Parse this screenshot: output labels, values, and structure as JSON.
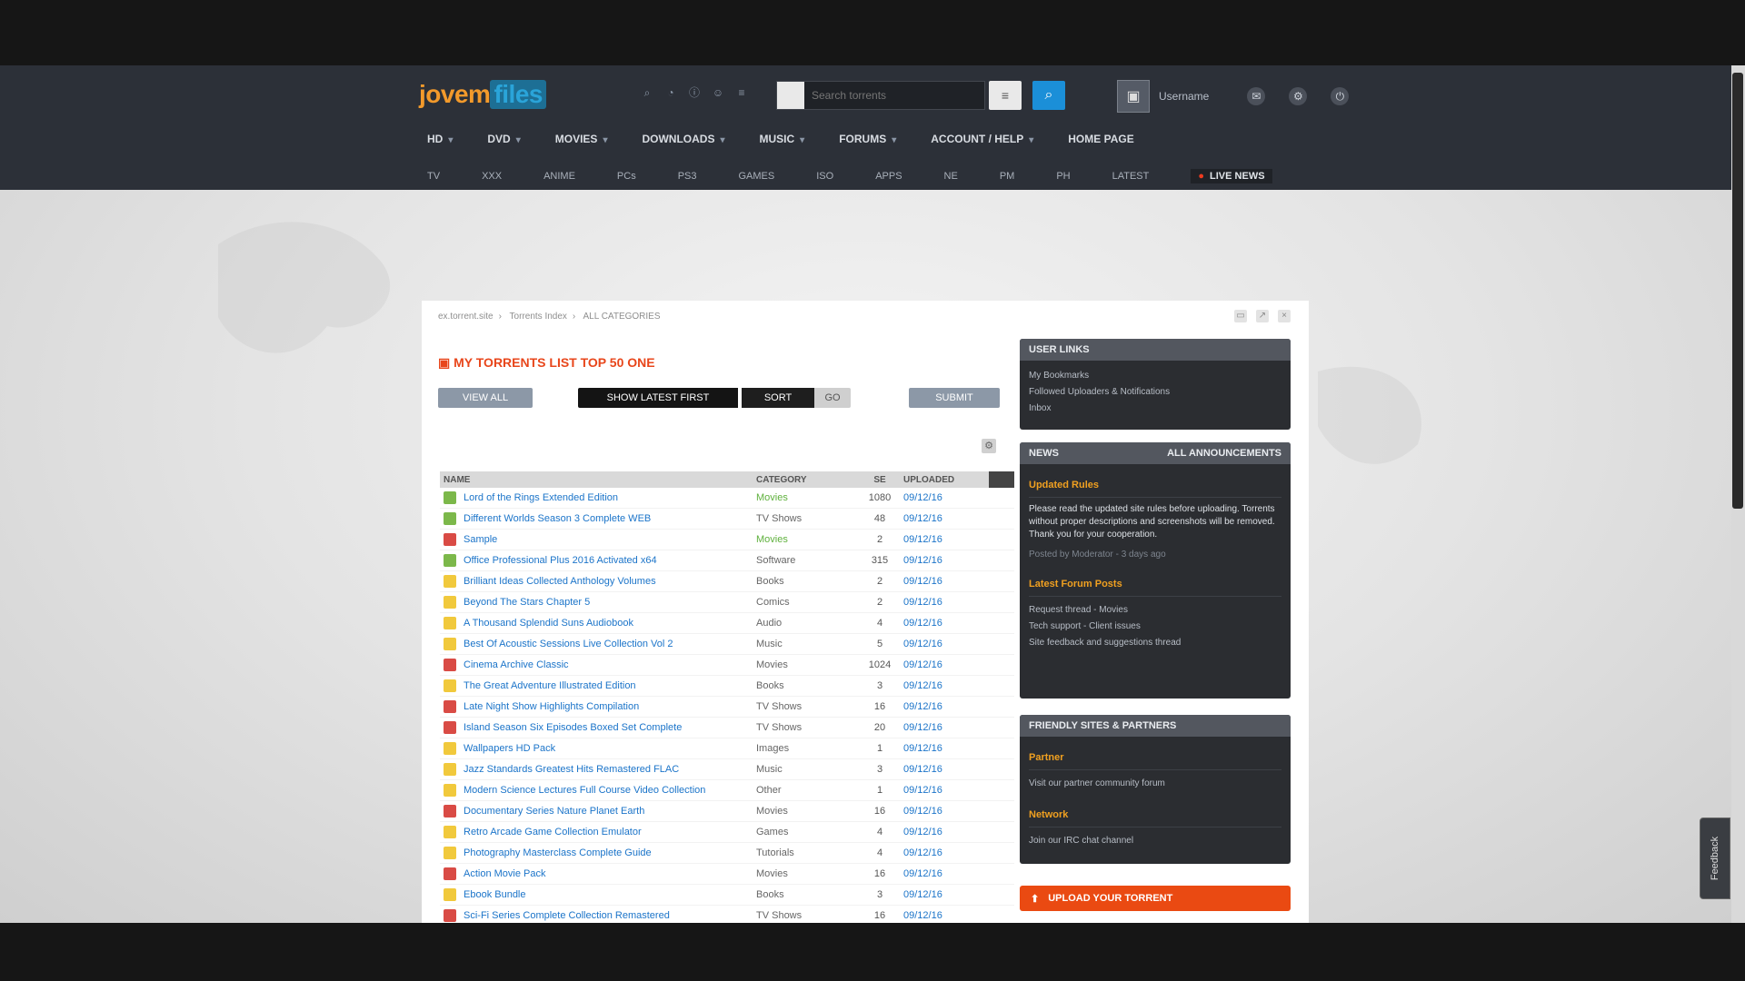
{
  "header": {
    "logo_part1": "jovem",
    "logo_part2": "files",
    "search_placeholder": "Search torrents",
    "search_checkbox": "",
    "adv_button": "≡",
    "search_button": "⌕",
    "username": "Username",
    "toolbar_icons": [
      "search-icon",
      "rss-icon",
      "info-icon",
      "user-icon",
      "list-icon"
    ]
  },
  "mainnav": [
    {
      "label": "HD",
      "has_caret": true
    },
    {
      "label": "DVD",
      "has_caret": true
    },
    {
      "label": "MOVIES",
      "has_caret": true
    },
    {
      "label": "DOWNLOADS",
      "has_caret": true
    },
    {
      "label": "MUSIC",
      "has_caret": true
    },
    {
      "label": "FORUMS",
      "has_caret": true
    },
    {
      "label": "ACCOUNT / HELP",
      "has_caret": true
    },
    {
      "label": "HOME PAGE",
      "has_caret": false
    }
  ],
  "subnav": {
    "items": [
      "TV",
      "XXX",
      "ANIME",
      "PCs",
      "PS3",
      "GAMES",
      "ISO",
      "APPS",
      "NE",
      "PM",
      "PH",
      "LATEST"
    ],
    "live_label": "LIVE NEWS"
  },
  "card": {
    "breadcrumb": [
      "ex.torrent.site",
      "Torrents Index",
      "ALL CATEGORIES"
    ],
    "title": "MY TORRENTS LIST TOP 50 ONE",
    "btn_left": "VIEW ALL",
    "seg_a": "SHOW LATEST FIRST",
    "seg_b": "SORT",
    "seg_c": "GO",
    "btn_right": "SUBMIT",
    "gear": "⚙",
    "columns": [
      "NAME",
      "CATEGORY",
      "SE",
      "UPLOADED",
      ""
    ]
  },
  "torrents": [
    {
      "status": "g",
      "name": "Lord of the Rings Extended Edition",
      "category": "Movies",
      "cat_green": true,
      "files": "1080",
      "date": "09/12/16"
    },
    {
      "status": "g",
      "name": "Different Worlds Season 3 Complete WEB",
      "category": "TV Shows",
      "cat_green": false,
      "files": "48",
      "date": "09/12/16"
    },
    {
      "status": "r",
      "name": "Sample",
      "category": "Movies",
      "cat_green": true,
      "files": "2",
      "date": "09/12/16"
    },
    {
      "status": "g",
      "name": "Office Professional Plus 2016 Activated x64",
      "category": "Software",
      "cat_green": false,
      "files": "315",
      "date": "09/12/16"
    },
    {
      "status": "y",
      "name": "Brilliant Ideas Collected Anthology Volumes",
      "category": "Books",
      "cat_green": false,
      "files": "2",
      "date": "09/12/16"
    },
    {
      "status": "y",
      "name": "Beyond The Stars Chapter 5",
      "category": "Comics",
      "cat_green": false,
      "files": "2",
      "date": "09/12/16"
    },
    {
      "status": "y",
      "name": "A Thousand Splendid Suns Audiobook",
      "category": "Audio",
      "cat_green": false,
      "files": "4",
      "date": "09/12/16"
    },
    {
      "status": "y",
      "name": "Best Of Acoustic Sessions Live Collection Vol 2",
      "category": "Music",
      "cat_green": false,
      "files": "5",
      "date": "09/12/16"
    },
    {
      "status": "r",
      "name": "Cinema Archive Classic",
      "category": "Movies",
      "cat_green": false,
      "files": "1024",
      "date": "09/12/16"
    },
    {
      "status": "y",
      "name": "The Great Adventure Illustrated Edition",
      "category": "Books",
      "cat_green": false,
      "files": "3",
      "date": "09/12/16"
    },
    {
      "status": "r",
      "name": "Late Night Show Highlights Compilation",
      "category": "TV Shows",
      "cat_green": false,
      "files": "16",
      "date": "09/12/16"
    },
    {
      "status": "r",
      "name": "Island Season Six Episodes Boxed Set Complete",
      "category": "TV Shows",
      "cat_green": false,
      "files": "20",
      "date": "09/12/16"
    },
    {
      "status": "y",
      "name": "Wallpapers HD Pack",
      "category": "Images",
      "cat_green": false,
      "files": "1",
      "date": "09/12/16"
    },
    {
      "status": "y",
      "name": "Jazz Standards Greatest Hits Remastered FLAC",
      "category": "Music",
      "cat_green": false,
      "files": "3",
      "date": "09/12/16"
    },
    {
      "status": "y",
      "name": "Modern Science Lectures Full Course Video Collection",
      "category": "Other",
      "cat_green": false,
      "files": "1",
      "date": "09/12/16"
    },
    {
      "status": "r",
      "name": "Documentary Series Nature Planet Earth",
      "category": "Movies",
      "cat_green": false,
      "files": "16",
      "date": "09/12/16"
    },
    {
      "status": "y",
      "name": "Retro Arcade Game Collection Emulator",
      "category": "Games",
      "cat_green": false,
      "files": "4",
      "date": "09/12/16"
    },
    {
      "status": "y",
      "name": "Photography Masterclass Complete Guide",
      "category": "Tutorials",
      "cat_green": false,
      "files": "4",
      "date": "09/12/16"
    },
    {
      "status": "r",
      "name": "Action Movie Pack",
      "category": "Movies",
      "cat_green": false,
      "files": "16",
      "date": "09/12/16"
    },
    {
      "status": "y",
      "name": "Ebook Bundle",
      "category": "Books",
      "cat_green": false,
      "files": "3",
      "date": "09/12/16"
    },
    {
      "status": "r",
      "name": "Sci-Fi Series Complete Collection Remastered",
      "category": "TV Shows",
      "cat_green": false,
      "files": "16",
      "date": "09/12/16"
    }
  ],
  "sidebar": {
    "panel1": {
      "title": "USER LINKS",
      "lines": [
        "My Bookmarks",
        "Followed Uploaders & Notifications",
        "Inbox"
      ]
    },
    "panel2": {
      "title": "NEWS",
      "right": "ALL ANNOUNCEMENTS",
      "sub1": "Updated Rules",
      "news": "Please read the updated site rules before uploading. Torrents without proper descriptions and screenshots will be removed. Thank you for your cooperation.",
      "meta": "Posted by Moderator - 3 days ago",
      "sub2": "Latest Forum Posts",
      "posts": [
        "Request thread - Movies",
        "Tech support - Client issues",
        "Site feedback and suggestions thread"
      ]
    },
    "panel3": {
      "title": "FRIENDLY SITES & PARTNERS",
      "sub1": "Partner",
      "text1": "Visit our partner community forum",
      "sub2": "Network",
      "text2": "Join our IRC chat channel"
    },
    "banner": "UPLOAD YOUR TORRENT"
  },
  "side_tab": "Feedback"
}
